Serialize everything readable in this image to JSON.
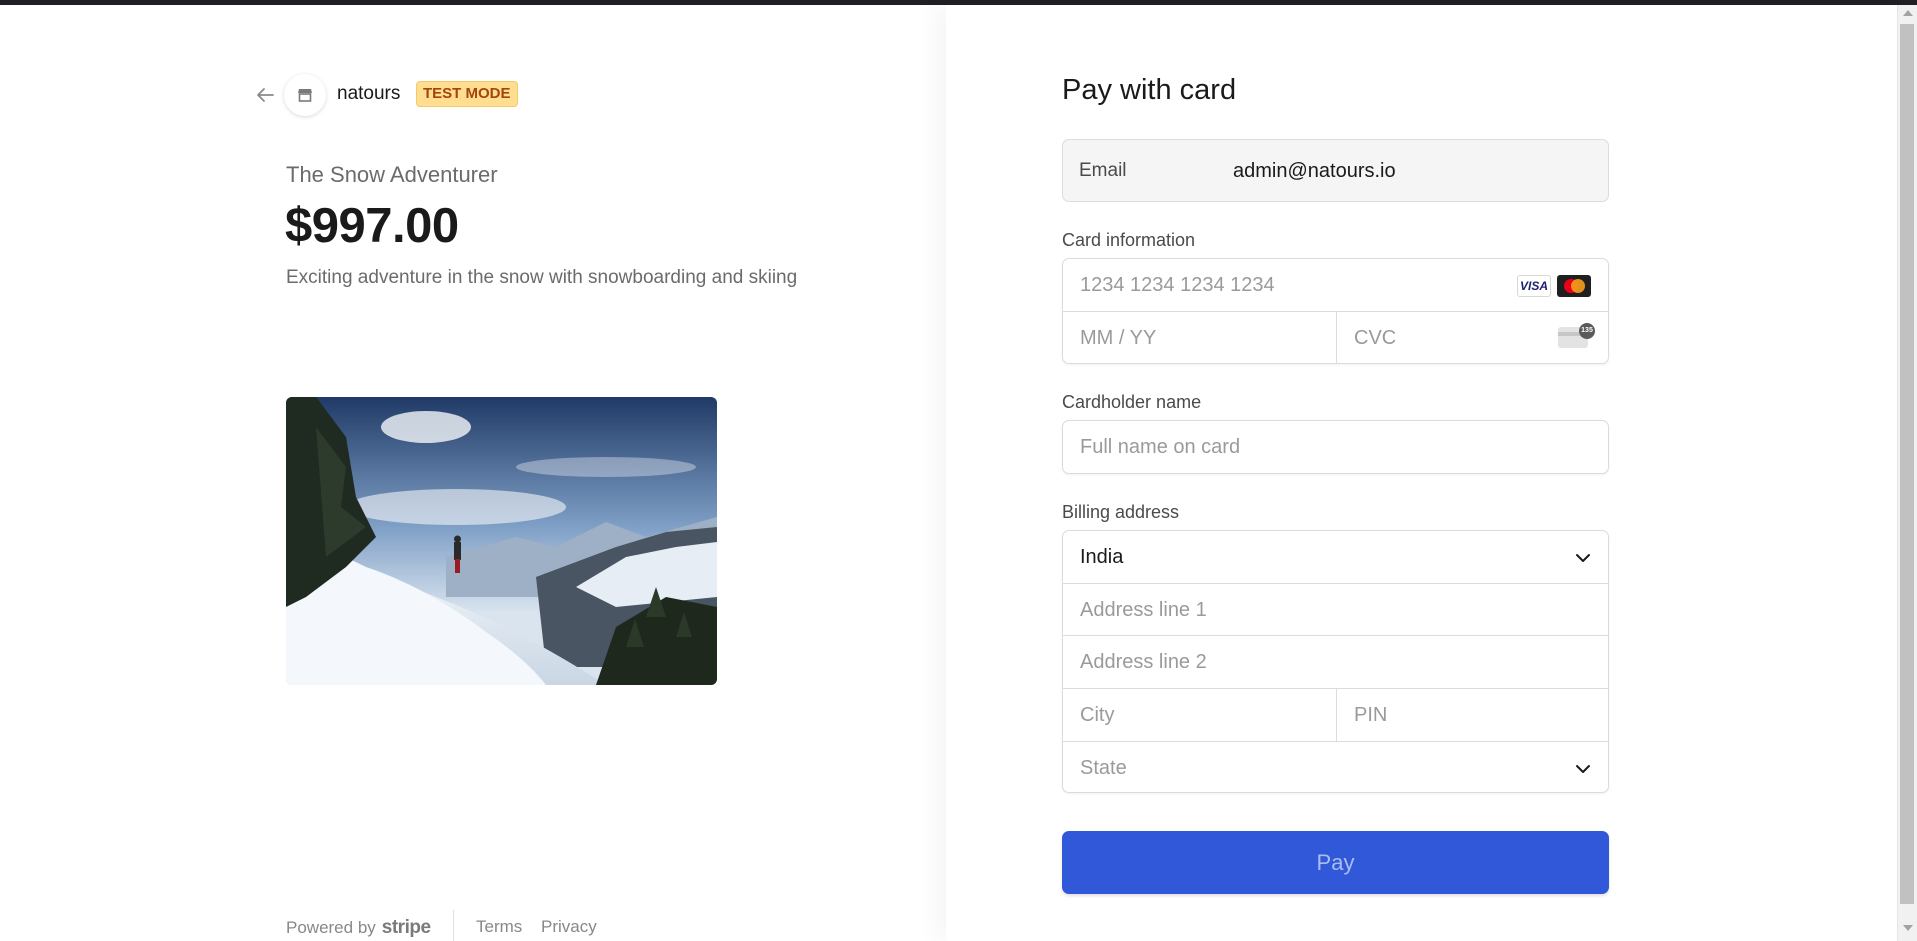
{
  "merchant": {
    "name": "natours",
    "test_badge": "TEST MODE"
  },
  "product": {
    "name": "The Snow Adventurer",
    "price": "$997.00",
    "description": "Exciting adventure in the snow with snowboarding and skiing"
  },
  "footer": {
    "powered_by": "Powered by",
    "brand": "stripe",
    "terms": "Terms",
    "privacy": "Privacy"
  },
  "form": {
    "title": "Pay with card",
    "email": {
      "label": "Email",
      "value": "admin@natours.io"
    },
    "card": {
      "label": "Card information",
      "number_placeholder": "1234 1234 1234 1234",
      "expiry_placeholder": "MM / YY",
      "cvc_placeholder": "CVC",
      "brands": [
        "visa-icon",
        "mastercard-icon"
      ],
      "visa_text": "VISA",
      "cvc_badge": "135"
    },
    "cardholder": {
      "label": "Cardholder name",
      "placeholder": "Full name on card"
    },
    "billing": {
      "label": "Billing address",
      "country": "India",
      "address1_placeholder": "Address line 1",
      "address2_placeholder": "Address line 2",
      "city_placeholder": "City",
      "pin_placeholder": "PIN",
      "state_placeholder": "State"
    },
    "pay_button": "Pay"
  },
  "colors": {
    "accent": "#3058d8",
    "test_badge_bg": "#ffde92",
    "test_badge_text": "#a3450d"
  }
}
